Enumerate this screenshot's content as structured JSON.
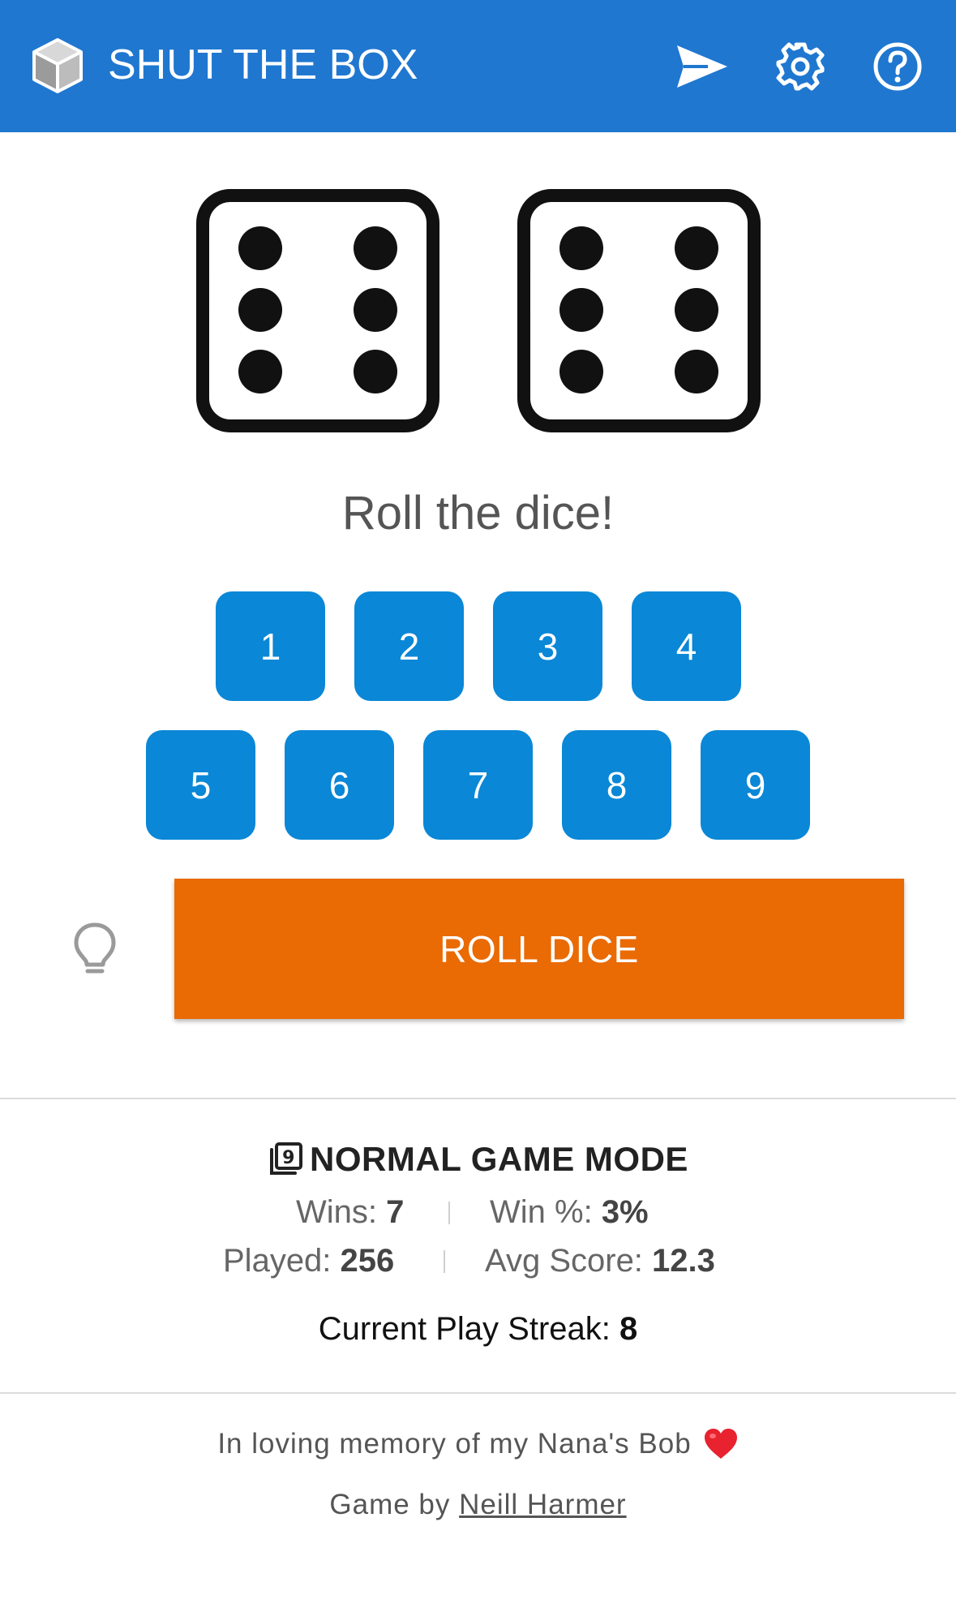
{
  "header": {
    "title": "SHUT THE BOX",
    "background": "#1f77d0",
    "icons": [
      "cube-logo-icon",
      "send-icon",
      "gear-icon",
      "help-circle-icon"
    ]
  },
  "dice": [
    {
      "value": 6
    },
    {
      "value": 6
    }
  ],
  "status_text": "Roll the dice!",
  "tiles": {
    "row1": [
      "1",
      "2",
      "3",
      "4"
    ],
    "row2": [
      "5",
      "6",
      "7",
      "8",
      "9"
    ],
    "color": "#0a87d6"
  },
  "hint_icon": "lightbulb-icon",
  "roll_button": {
    "label": "ROLL DICE",
    "color": "#ea6a04"
  },
  "stats": {
    "mode_title": "NORMAL GAME MODE",
    "wins_label": "Wins:",
    "wins": "7",
    "win_pct_label": "Win %:",
    "win_pct": "3%",
    "played_label": "Played:",
    "played": "256",
    "avg_label": "Avg Score:",
    "avg": "12.3",
    "streak_label": "Current Play Streak:",
    "streak": "8"
  },
  "footer": {
    "memory": "In loving memory of my Nana's Bob",
    "credit_prefix": "Game by",
    "author": "Neill Harmer"
  }
}
